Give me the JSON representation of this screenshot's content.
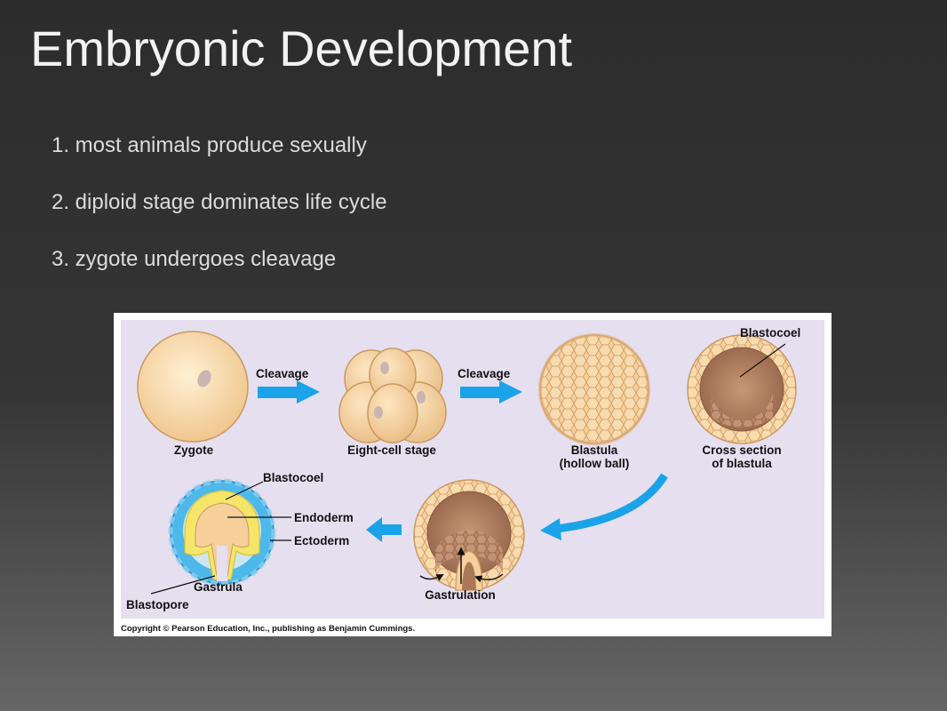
{
  "slide": {
    "title": "Embryonic Development",
    "bullets": [
      "1. most animals produce sexually",
      "2. diploid stage dominates life cycle",
      "3. zygote undergoes cleavage"
    ]
  },
  "figure": {
    "labels": {
      "cleavage_1": "Cleavage",
      "cleavage_2": "Cleavage",
      "zygote": "Zygote",
      "eight_cell": "Eight-cell stage",
      "blastula_line1": "Blastula",
      "blastula_line2": "(hollow ball)",
      "cross_section_line1": "Cross section",
      "cross_section_line2": "of blastula",
      "blastocoel_top": "Blastocoel",
      "blastocoel_gastrula": "Blastocoel",
      "endoderm": "Endoderm",
      "ectoderm": "Ectoderm",
      "gastrula": "Gastrula",
      "blastopore": "Blastopore",
      "gastrulation": "Gastrulation"
    },
    "copyright": "Copyright © Pearson Education, Inc., publishing as Benjamin Cummings.",
    "colors": {
      "panel_background": "#e6dff0",
      "arrow": "#1aa3e8",
      "cell_fill": "#f6cf9b",
      "cell_outline": "#c99a62",
      "ectoderm": "#4db8ea",
      "endoderm": "#f5e66a",
      "cavity": "#a9785a"
    }
  }
}
